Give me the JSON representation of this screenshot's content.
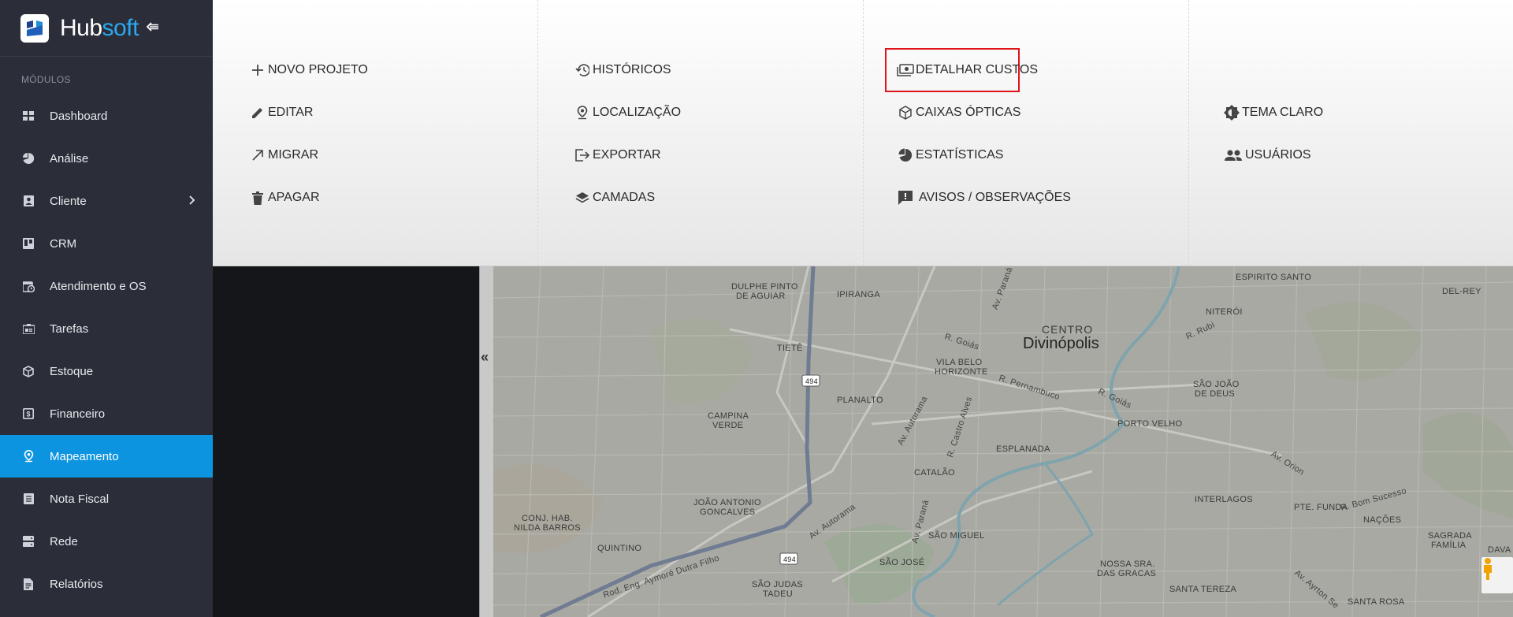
{
  "brand": {
    "name_part1": "Hub",
    "name_part2": "soft"
  },
  "sidebar": {
    "section_title": "MÓDULOS",
    "items": [
      {
        "label": "Dashboard",
        "icon": "dashboard-icon"
      },
      {
        "label": "Análise",
        "icon": "pie-chart-icon"
      },
      {
        "label": "Cliente",
        "icon": "contact-card-icon"
      },
      {
        "label": "CRM",
        "icon": "kanban-icon"
      },
      {
        "label": "Atendimento e OS",
        "icon": "calendar-clock-icon"
      },
      {
        "label": "Tarefas",
        "icon": "task-card-icon"
      },
      {
        "label": "Estoque",
        "icon": "box-icon"
      },
      {
        "label": "Financeiro",
        "icon": "money-icon"
      },
      {
        "label": "Mapeamento",
        "icon": "map-pin-icon",
        "active": true
      },
      {
        "label": "Nota Fiscal",
        "icon": "invoice-icon"
      },
      {
        "label": "Rede",
        "icon": "server-icon"
      },
      {
        "label": "Relatórios",
        "icon": "report-icon"
      }
    ]
  },
  "menu": {
    "col1": [
      "NOVO PROJETO",
      "EDITAR",
      "MIGRAR",
      "APAGAR"
    ],
    "col2": [
      "HISTÓRICOS",
      "LOCALIZAÇÃO",
      "EXPORTAR",
      "CAMADAS"
    ],
    "col3": [
      "DETALHAR CUSTOS",
      "CAIXAS ÓPTICAS",
      "ESTATÍSTICAS",
      "AVISOS / OBSERVAÇÕES"
    ],
    "col4": [
      "TEMA CLARO",
      "USUÁRIOS"
    ]
  },
  "map": {
    "labels": [
      "DULPHE PINTO",
      "DE AGUIAR",
      "IPIRANGA",
      "ESPIRITO SANTO",
      "DEL-REY",
      "NITERÓI",
      "CENTRO",
      "Divinópolis",
      "TIETÊ",
      "VILA BELO",
      "HORIZONTE",
      "SÃO JOÃO",
      "DE DEUS",
      "PLANALTO",
      "CAMPINA",
      "VERDE",
      "PORTO VELHO",
      "ESPLANADA",
      "CATALÃO",
      "JOÃO ANTONIO",
      "GONCALVES",
      "CONJ. HAB.",
      "NILDA BARROS",
      "SÃO MIGUEL",
      "INTERLAGOS",
      "PTE. FUNDA",
      "NAÇÕES",
      "SAGRADA",
      "FAMÍLIA",
      "QUINTINO",
      "SÃO JOSÉ",
      "NOSSA SRA.",
      "DAS GRACAS",
      "SANTA TEREZA",
      "SANTA ROSA",
      "SÃO JUDAS",
      "TADEU",
      "DAVA"
    ],
    "streets": [
      "Av. Paraná",
      "R. Goiás",
      "R. Rubi",
      "R. Pernambuco",
      "Av. Autorama",
      "R. Castro Alves",
      "Av. Orion",
      "R. Bom Sucesso",
      "Av. Ayrton Se",
      "Rod. Eng. Aymoré Dutra Filho"
    ],
    "shields": [
      "494",
      "494"
    ]
  },
  "colors": {
    "accent": "#0d94e0",
    "sidebar_bg": "#2b2e38",
    "highlight": "#e0141b"
  }
}
